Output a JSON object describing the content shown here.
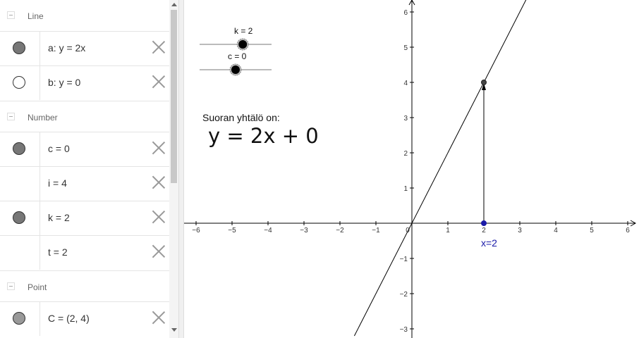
{
  "algebra": {
    "sections": {
      "line": "Line",
      "number": "Number",
      "point": "Point"
    },
    "items": {
      "a": "a: y = 2x",
      "b": "b: y = 0",
      "c": "c = 0",
      "i": "i = 4",
      "k": "k = 2",
      "t": "t = 2",
      "C": "C = (2, 4)"
    }
  },
  "sliders": {
    "k_label": "k = 2",
    "k_value": 2,
    "c_label": "c = 0",
    "c_value": 0
  },
  "text": {
    "caption": "Suoran yhtälö on:",
    "equation": "y = 2x + 0"
  },
  "point_label": "x=2",
  "axes": {
    "x_ticks": [
      "-6",
      "-5",
      "-4",
      "-3",
      "-2",
      "-1",
      "0",
      "1",
      "2",
      "3",
      "4",
      "5",
      "6"
    ],
    "y_ticks": [
      "6",
      "5",
      "4",
      "3",
      "2",
      "1",
      "-1",
      "-2",
      "-3"
    ]
  },
  "colors": {
    "point_blue": "#1a1aa8",
    "line": "#000000"
  }
}
